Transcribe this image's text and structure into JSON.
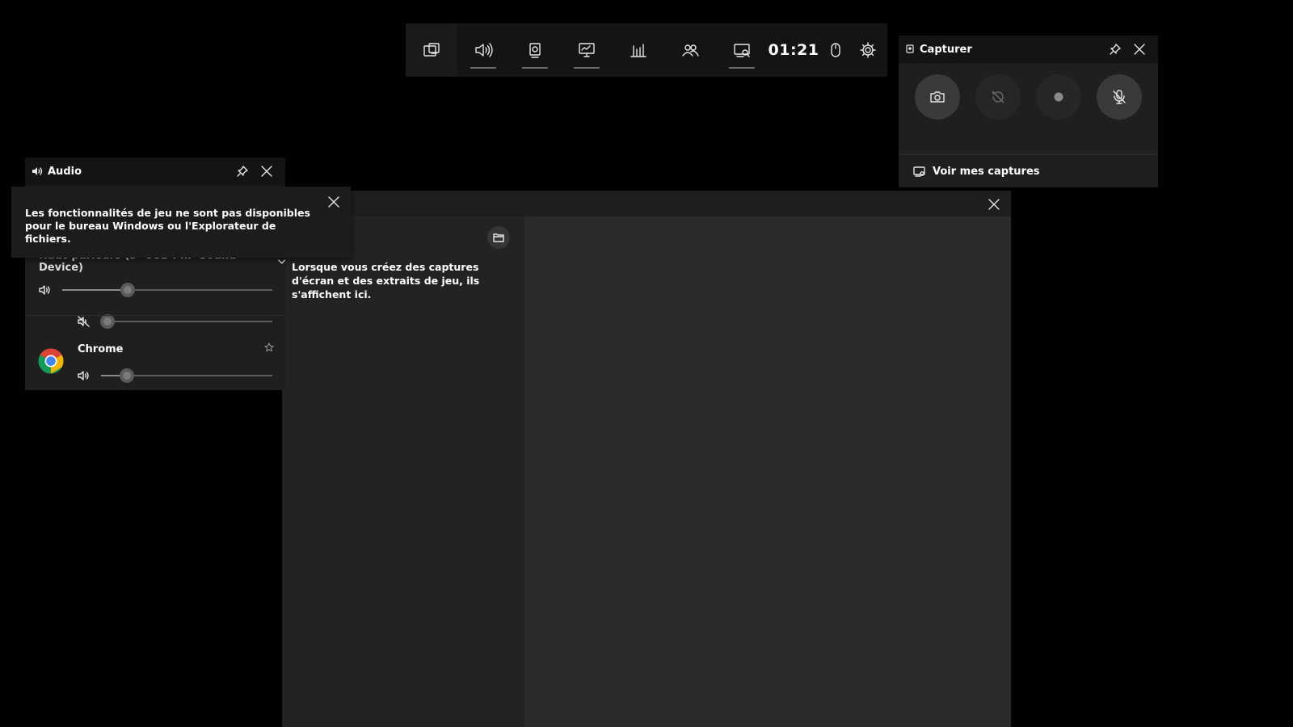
{
  "topbar": {
    "widgets": [
      {
        "name": "widget-menu",
        "icon": "widget-menu-icon",
        "underline": false
      },
      {
        "name": "audio",
        "icon": "speaker-icon",
        "underline": true
      },
      {
        "name": "capture",
        "icon": "capture-icon",
        "underline": true
      },
      {
        "name": "performance",
        "icon": "performance-icon",
        "underline": true
      },
      {
        "name": "resources",
        "icon": "resources-chart-icon",
        "underline": false
      },
      {
        "name": "social",
        "icon": "people-icon",
        "underline": false
      },
      {
        "name": "gallery",
        "icon": "gallery-icon",
        "underline": true
      }
    ],
    "clock": "01:21"
  },
  "capture": {
    "title": "Capturer",
    "buttons": [
      "screenshot-icon",
      "record-last-icon",
      "record-icon",
      "mic-off-icon"
    ],
    "footer_label": "Voir mes captures"
  },
  "gallery": {
    "empty_message": "Lorsque vous créez des captures d'écran et des extraits de jeu, ils s'affichent ici."
  },
  "audio": {
    "title": "Audio",
    "device": "Haut-parleurs (3- USB PnP Sound Device)",
    "master_volume": 0.31,
    "system_sounds_volume": 0.04,
    "apps": [
      {
        "name": "Chrome",
        "volume": 0.15
      }
    ]
  },
  "notification": {
    "text": "Les fonctionnalités de jeu ne sont pas disponibles pour le bureau Windows ou l'Explorateur de fichiers."
  },
  "colors": {
    "bar_bg": "#141414",
    "panel_bg": "#1f1f1f",
    "gallery_bg": "#2a2a2a"
  }
}
